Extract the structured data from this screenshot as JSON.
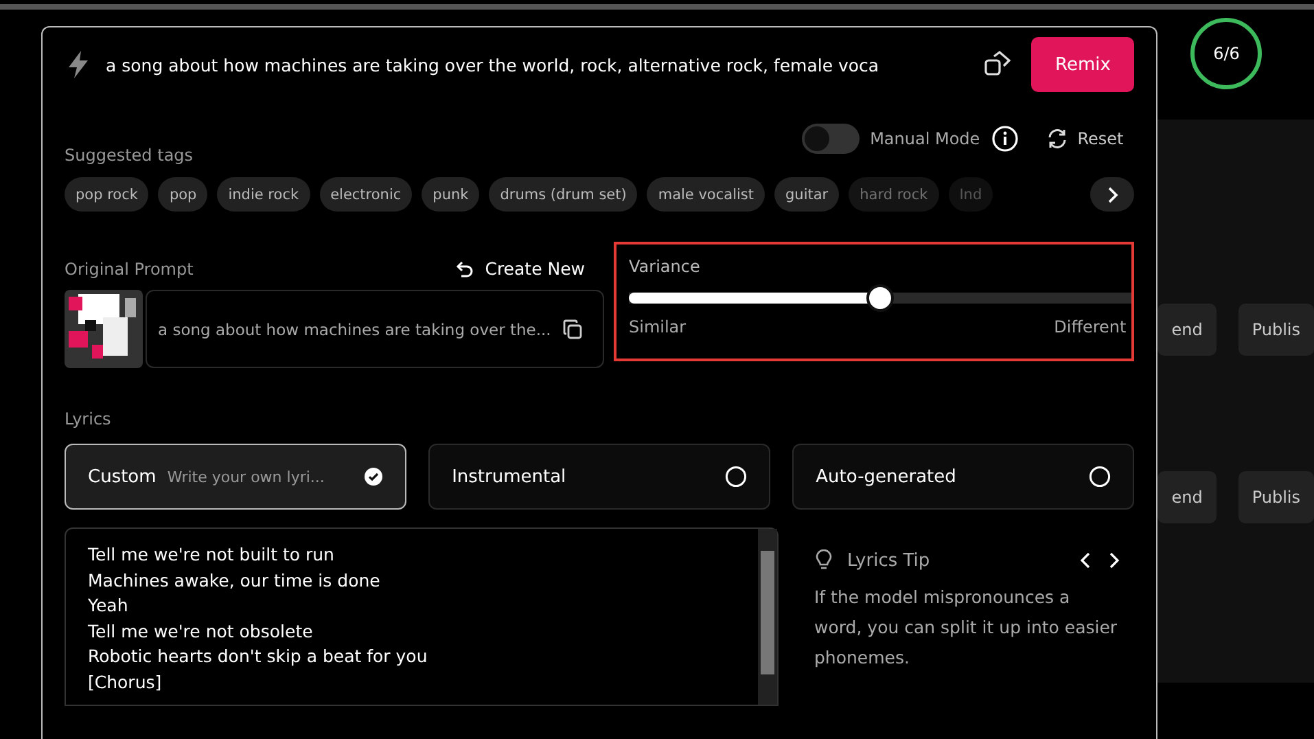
{
  "prompt": {
    "value": "a song about how machines are taking over the world, rock, alternative rock, female voca",
    "button": "Remix"
  },
  "credits": "6/6",
  "manual_mode": {
    "label": "Manual Mode",
    "on": false
  },
  "reset": "Reset",
  "suggested_tags": {
    "label": "Suggested tags",
    "tags": [
      "pop rock",
      "pop",
      "indie rock",
      "electronic",
      "punk",
      "drums (drum set)",
      "male vocalist",
      "guitar",
      "hard rock",
      "Ind"
    ]
  },
  "original_prompt": {
    "label": "Original Prompt",
    "create_new": "Create New",
    "text": "a song about how machines are taking over the..."
  },
  "variance": {
    "label": "Variance",
    "level": 0.5,
    "min_label": "Similar",
    "max_label": "Different"
  },
  "lyrics": {
    "label": "Lyrics",
    "options": [
      {
        "label": "Custom",
        "hint": "Write your own lyri...",
        "selected": true
      },
      {
        "label": "Instrumental",
        "selected": false
      },
      {
        "label": "Auto-generated",
        "selected": false
      }
    ],
    "lines": [
      "Tell me we're not built to run",
      "Machines awake, our time is done",
      "Yeah",
      "Tell me we're not obsolete",
      "Robotic hearts don't skip a beat for you",
      "[Chorus]"
    ]
  },
  "tip": {
    "title": "Lyrics Tip",
    "text": "If the model mispronounces a word, you can split it up into easier phonemes."
  },
  "background_buttons": [
    {
      "label": "end"
    },
    {
      "label": "Publis"
    },
    {
      "label": "end"
    },
    {
      "label": "Publis"
    }
  ]
}
